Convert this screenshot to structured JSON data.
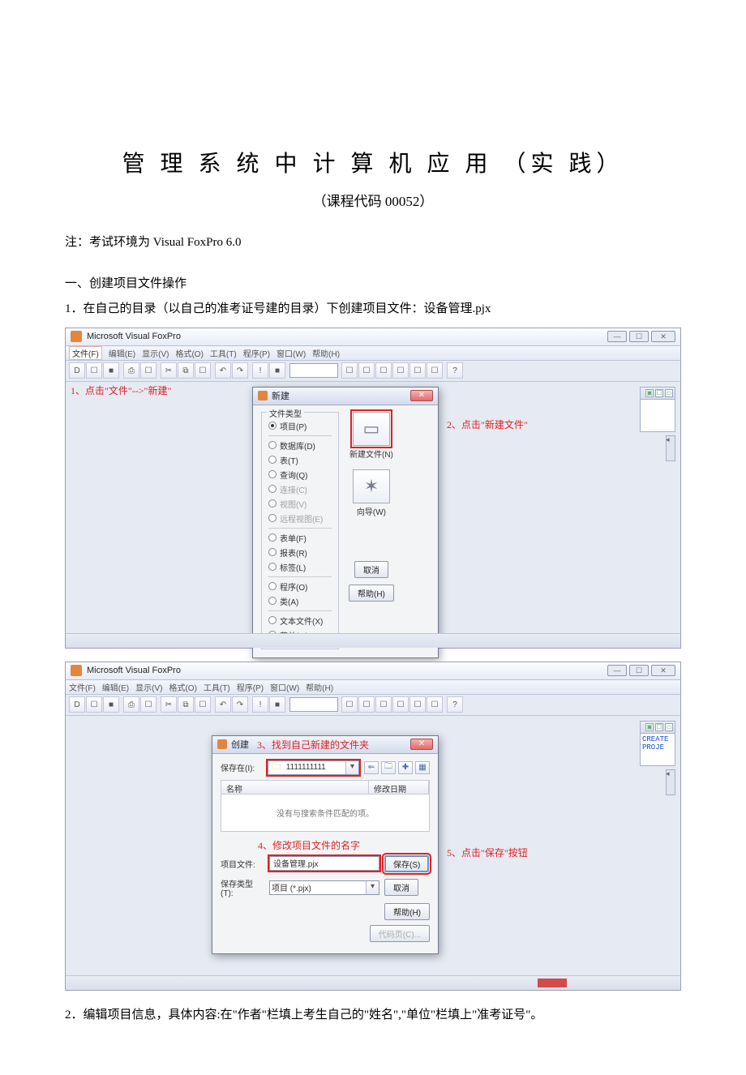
{
  "doc": {
    "title": "管 理 系 统 中 计 算 机 应 用 （实 践）",
    "subtitle": "（课程代码   00052）",
    "note_prefix": "注：考试环境为 ",
    "note_env": "Visual FoxPro 6.0",
    "section1": "一、创建项目文件操作",
    "step1_num": "1．",
    "step1_text": "在自己的目录（以自己的准考证号建的目录）下创建项目文件：设备管理.pjx",
    "step2_num": "2．",
    "step2_text": "编辑项目信息，具体内容:在\"作者\"栏填上考生自己的\"姓名\",\"单位\"栏填上\"准考证号\"。"
  },
  "app": {
    "title": "Microsoft Visual FoxPro",
    "menu": {
      "file": "文件(F)",
      "edit": "编辑(E)",
      "view": "显示(V)",
      "format": "格式(O)",
      "tools": "工具(T)",
      "program": "程序(P)",
      "window": "窗口(W)",
      "help": "帮助(H)"
    },
    "icons": {
      "new": "D",
      "open": "☐",
      "save": "■",
      "print": "⎙",
      "preview": "☐",
      "cut": "✂",
      "copy": "⧉",
      "paste": "☐",
      "undo": "↶",
      "redo": "↷",
      "run": "!",
      "stop": "■",
      "db": "☐",
      "win": "☐",
      "a": "☐",
      "b": "☐",
      "c": "☐",
      "d": "☐",
      "help": "?"
    },
    "winbtns": {
      "min": "—",
      "max": "☐",
      "close": "✕"
    }
  },
  "anno": {
    "a1": "1、点击\"文件\"-->\"新建\"",
    "a2": "2、点击\"新建文件\"",
    "a3": "3、找到自己新建的文件夹",
    "a4": "4、修改项目文件的名字",
    "a5": "5、点击\"保存\"按钮"
  },
  "dlg_new": {
    "title": "新建",
    "group": "文件类型",
    "opts": {
      "project": "项目(P)",
      "database": "数据库(D)",
      "table": "表(T)",
      "query": "查询(Q)",
      "conn": "连接(C)",
      "view": "视图(V)",
      "remote": "远程视图(E)",
      "form": "表单(F)",
      "report": "报表(R)",
      "label": "标签(L)",
      "program": "程序(O)",
      "class": "类(A)",
      "textfile": "文本文件(X)",
      "menu": "菜单(M)"
    },
    "btn_newfile": "新建文件(N)",
    "btn_wizard": "向导(W)",
    "btn_cancel": "取消",
    "btn_help": "帮助(H)"
  },
  "dlg_save": {
    "title": "创建",
    "savein_label": "保存在(I):",
    "folder": "1111111111",
    "col_name": "名称",
    "col_date": "修改日期",
    "empty": "没有与搜索条件匹配的项。",
    "projfile_label": "项目文件:",
    "projfile_value": "设备管理.pjx",
    "savetype_label": "保存类型(T):",
    "savetype_value": "项目 (*.pjx)",
    "btn_save": "保存(S)",
    "btn_cancel": "取消",
    "btn_help": "帮助(H)",
    "btn_code": "代码页(C)..."
  },
  "cmdwin": {
    "text": "CREATE PROJE"
  }
}
